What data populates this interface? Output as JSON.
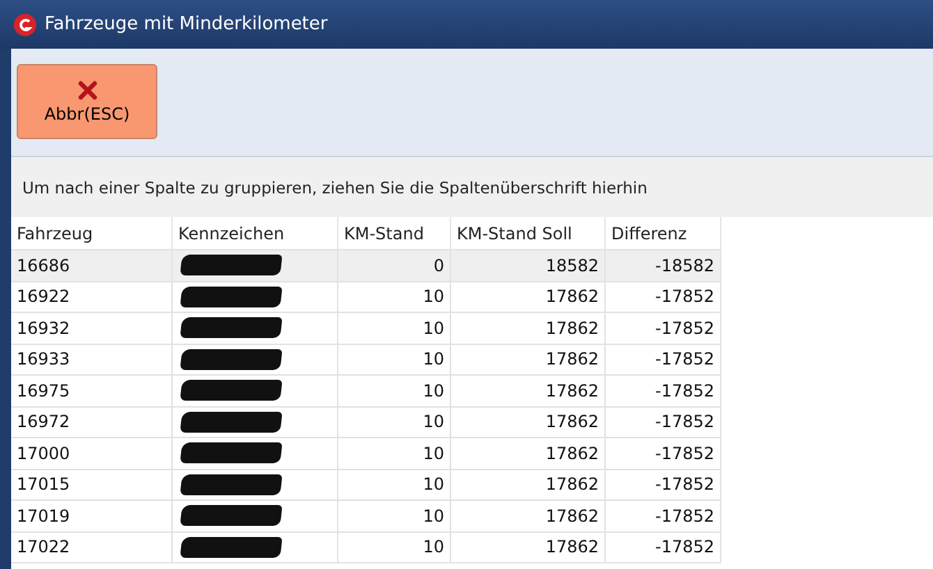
{
  "window": {
    "title": "Fahrzeuge mit Minderkilometer"
  },
  "toolbar": {
    "buttons": [
      {
        "label": "Abbr(ESC)"
      }
    ]
  },
  "group_panel": {
    "hint": "Um nach einer Spalte zu gruppieren, ziehen Sie die Spaltenüberschrift hierhin"
  },
  "table": {
    "columns": [
      "Fahrzeug",
      "Kennzeichen",
      "KM-Stand",
      "KM-Stand Soll",
      "Differenz"
    ],
    "rows": [
      {
        "fahrzeug": "16686",
        "kennzeichen_redacted": true,
        "km_stand": "0",
        "km_stand_soll": "18582",
        "differenz": "-18582",
        "selected": true
      },
      {
        "fahrzeug": "16922",
        "kennzeichen_redacted": true,
        "km_stand": "10",
        "km_stand_soll": "17862",
        "differenz": "-17852",
        "selected": false
      },
      {
        "fahrzeug": "16932",
        "kennzeichen_redacted": true,
        "km_stand": "10",
        "km_stand_soll": "17862",
        "differenz": "-17852",
        "selected": false
      },
      {
        "fahrzeug": "16933",
        "kennzeichen_redacted": true,
        "km_stand": "10",
        "km_stand_soll": "17862",
        "differenz": "-17852",
        "selected": false
      },
      {
        "fahrzeug": "16975",
        "kennzeichen_redacted": true,
        "km_stand": "10",
        "km_stand_soll": "17862",
        "differenz": "-17852",
        "selected": false
      },
      {
        "fahrzeug": "16972",
        "kennzeichen_redacted": true,
        "km_stand": "10",
        "km_stand_soll": "17862",
        "differenz": "-17852",
        "selected": false
      },
      {
        "fahrzeug": "17000",
        "kennzeichen_redacted": true,
        "km_stand": "10",
        "km_stand_soll": "17862",
        "differenz": "-17852",
        "selected": false
      },
      {
        "fahrzeug": "17015",
        "kennzeichen_redacted": true,
        "km_stand": "10",
        "km_stand_soll": "17862",
        "differenz": "-17852",
        "selected": false
      },
      {
        "fahrzeug": "17019",
        "kennzeichen_redacted": true,
        "km_stand": "10",
        "km_stand_soll": "17862",
        "differenz": "-17852",
        "selected": false
      },
      {
        "fahrzeug": "17022",
        "kennzeichen_redacted": true,
        "km_stand": "10",
        "km_stand_soll": "17862",
        "differenz": "-17852",
        "selected": false
      }
    ]
  }
}
